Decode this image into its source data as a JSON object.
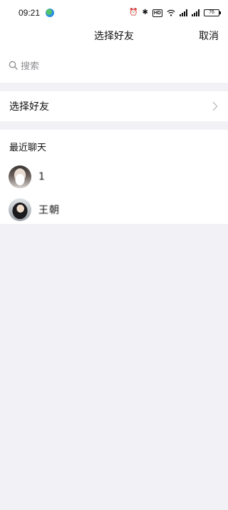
{
  "status_bar": {
    "time": "09:21",
    "hd_label": "HD",
    "battery_level": "76",
    "icons": [
      "app-icon",
      "alarm-icon",
      "bluetooth-icon",
      "hd-icon",
      "wifi-icon",
      "signal-icon",
      "signal-icon",
      "battery-icon"
    ]
  },
  "header": {
    "title": "选择好友",
    "cancel_label": "取消"
  },
  "search": {
    "placeholder": "搜索",
    "icon": "search-icon"
  },
  "select_friends": {
    "label": "选择好友",
    "icon": "chevron-right-icon"
  },
  "recent_chats": {
    "title": "最近聊天",
    "contacts": [
      {
        "name": "1"
      },
      {
        "name": "王朝"
      }
    ]
  },
  "colors": {
    "background": "#f2f1f6",
    "surface": "#ffffff",
    "placeholder": "#8e8e93",
    "text": "#111111"
  }
}
